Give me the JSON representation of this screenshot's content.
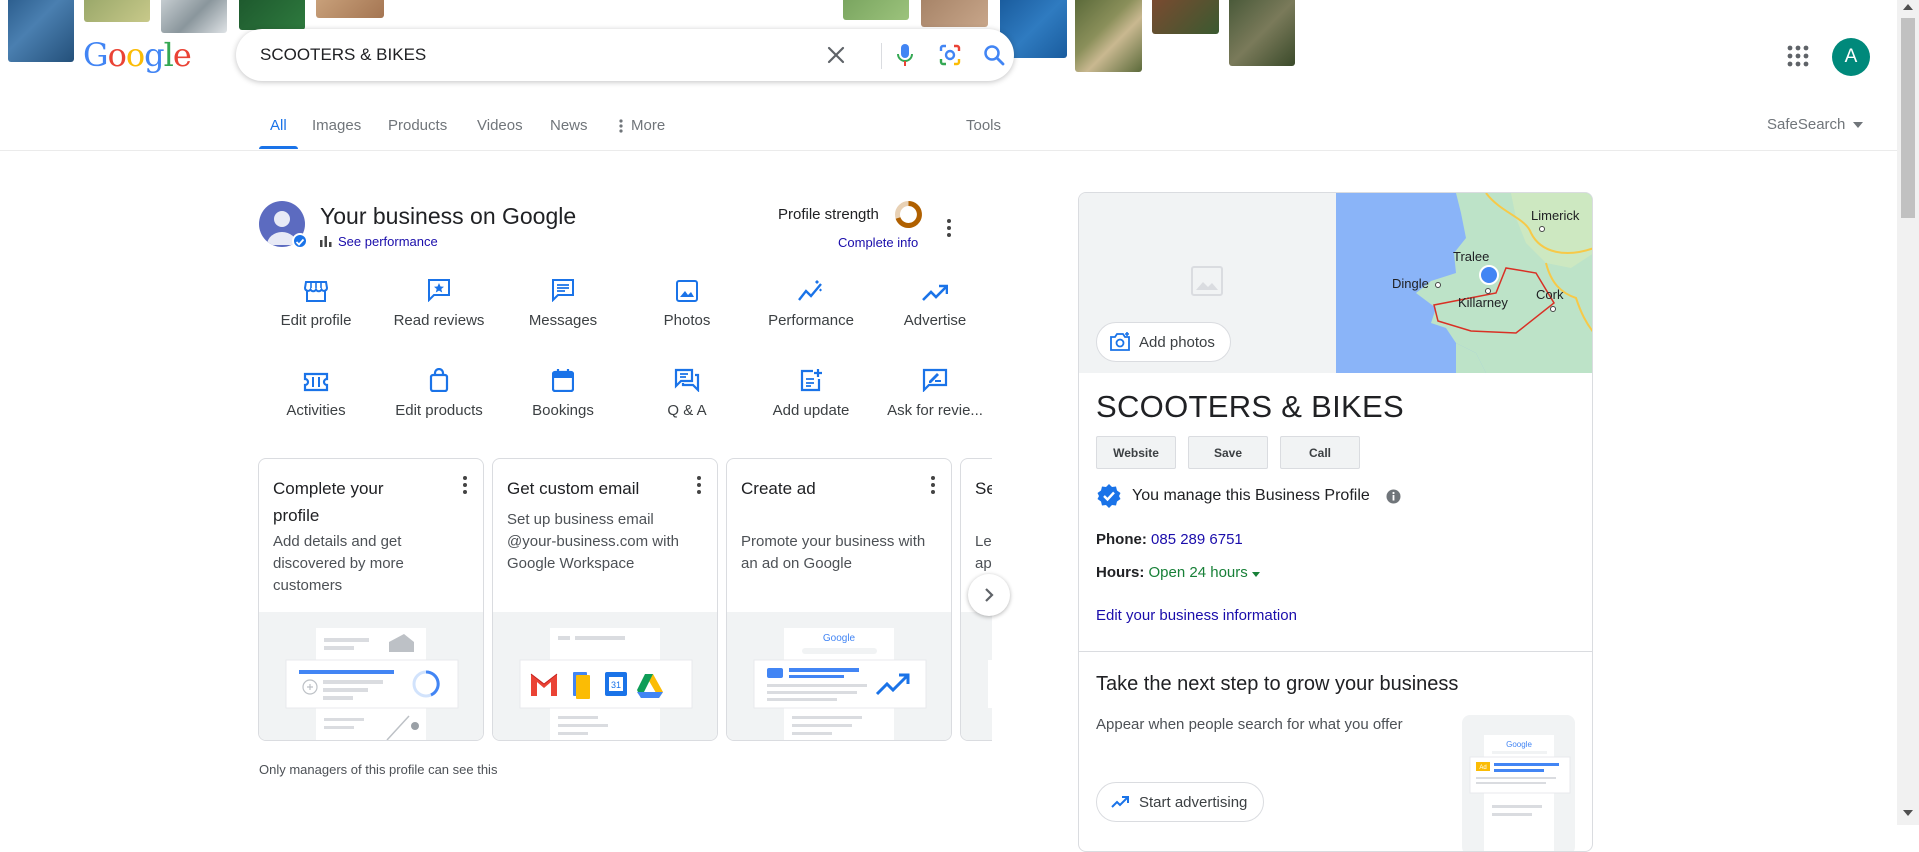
{
  "header": {
    "logo": [
      "G",
      "o",
      "o",
      "g",
      "l",
      "e"
    ],
    "logo_colors": [
      "#4285f4",
      "#ea4335",
      "#fbbc05",
      "#4285f4",
      "#34a853",
      "#ea4335"
    ],
    "search_value": "SCOOTERS & BIKES",
    "avatar_letter": "A"
  },
  "tabs": [
    {
      "label": "All",
      "active": true
    },
    {
      "label": "Images"
    },
    {
      "label": "Products"
    },
    {
      "label": "Videos"
    },
    {
      "label": "News"
    },
    {
      "label": "More"
    }
  ],
  "tools_label": "Tools",
  "safesearch_label": "SafeSearch",
  "business": {
    "title": "Your business on Google",
    "see_performance": "See performance",
    "profile_strength": "Profile strength",
    "complete_info": "Complete info",
    "actions_row1": [
      {
        "label": "Edit profile",
        "icon": "storefront-icon"
      },
      {
        "label": "Read reviews",
        "icon": "star-review-icon"
      },
      {
        "label": "Messages",
        "icon": "message-icon"
      },
      {
        "label": "Photos",
        "icon": "photo-icon"
      },
      {
        "label": "Performance",
        "icon": "performance-icon"
      },
      {
        "label": "Advertise",
        "icon": "trending-up-icon"
      }
    ],
    "actions_row2": [
      {
        "label": "Activities",
        "icon": "ticket-icon"
      },
      {
        "label": "Edit products",
        "icon": "shopping-bag-icon"
      },
      {
        "label": "Bookings",
        "icon": "calendar-icon"
      },
      {
        "label": "Q & A",
        "icon": "forum-icon"
      },
      {
        "label": "Add update",
        "icon": "post-add-icon"
      },
      {
        "label": "Ask for revie...",
        "icon": "rate-review-icon"
      }
    ],
    "cards": [
      {
        "title": "Complete your profile",
        "desc": "Add details and get discovered by more customers"
      },
      {
        "title": "Get custom email",
        "desc": "Set up business email @your-business.com with Google Workspace"
      },
      {
        "title": "Create ad",
        "desc": "Promote your business with an ad on Google"
      },
      {
        "title": "Se",
        "desc": "Le ap"
      }
    ],
    "managers_note": "Only managers of this profile can see this"
  },
  "knowledge_panel": {
    "add_photos": "Add photos",
    "map_labels": [
      "Limerick",
      "Tralee",
      "Dingle",
      "Killarney",
      "Cork"
    ],
    "name": "SCOOTERS & BIKES",
    "buttons": [
      "Website",
      "Save",
      "Call"
    ],
    "manage_text": "You manage this Business Profile",
    "phone_label": "Phone:",
    "phone_value": "085 289 6751",
    "hours_label": "Hours:",
    "hours_value": "Open 24 hours",
    "edit_info": "Edit your business information",
    "grow_title": "Take the next step to grow your business",
    "grow_desc": "Appear when people search for what you offer",
    "start_advertising": "Start advertising",
    "mini_logo": "Google",
    "ad_badge": "Ad"
  },
  "cards_images": {
    "workspace_calendar_day": "31",
    "mini_logo": "Google"
  }
}
